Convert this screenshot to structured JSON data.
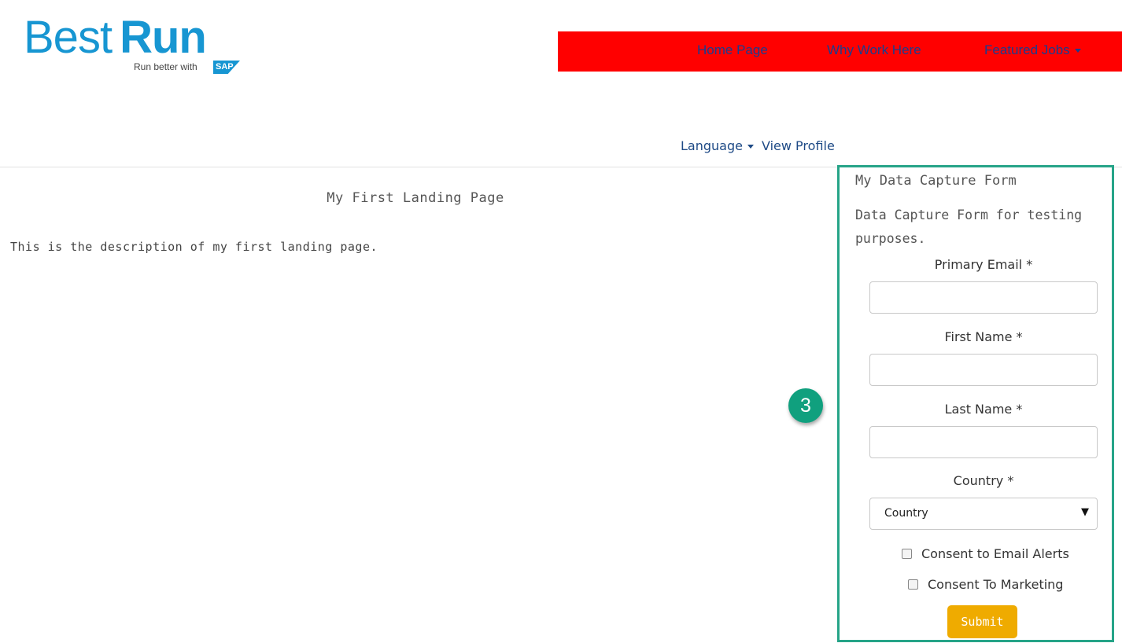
{
  "logo": {
    "word_best": "Best",
    "word_run": "Run",
    "tagline": "Run better with",
    "sap_mark": "SAP"
  },
  "nav": {
    "items": [
      {
        "label": "Home Page"
      },
      {
        "label": "Why Work Here"
      },
      {
        "label": "Featured Jobs",
        "dropdown": true
      }
    ],
    "background_color": "#ff0000",
    "link_color": "#1a3d8f"
  },
  "utility_links": {
    "language": "Language",
    "view_profile": "View Profile"
  },
  "main": {
    "title": "My First Landing Page",
    "description": "This is the description of my first landing page."
  },
  "annotation": {
    "badge_number": "3",
    "color": "#10a07e"
  },
  "form": {
    "title": "My Data Capture Form",
    "subtitle": "Data Capture Form for testing purposes.",
    "fields": [
      {
        "label": "Primary Email *",
        "value": ""
      },
      {
        "label": "First Name *",
        "value": ""
      },
      {
        "label": "Last Name *",
        "value": ""
      }
    ],
    "country": {
      "label": "Country *",
      "selected": "Country"
    },
    "checkboxes": [
      {
        "label": "Consent to Email Alerts",
        "checked": false
      },
      {
        "label": "Consent To Marketing",
        "checked": false
      }
    ],
    "submit_label": "Submit",
    "border_color": "#26a488",
    "submit_color": "#efab00"
  }
}
